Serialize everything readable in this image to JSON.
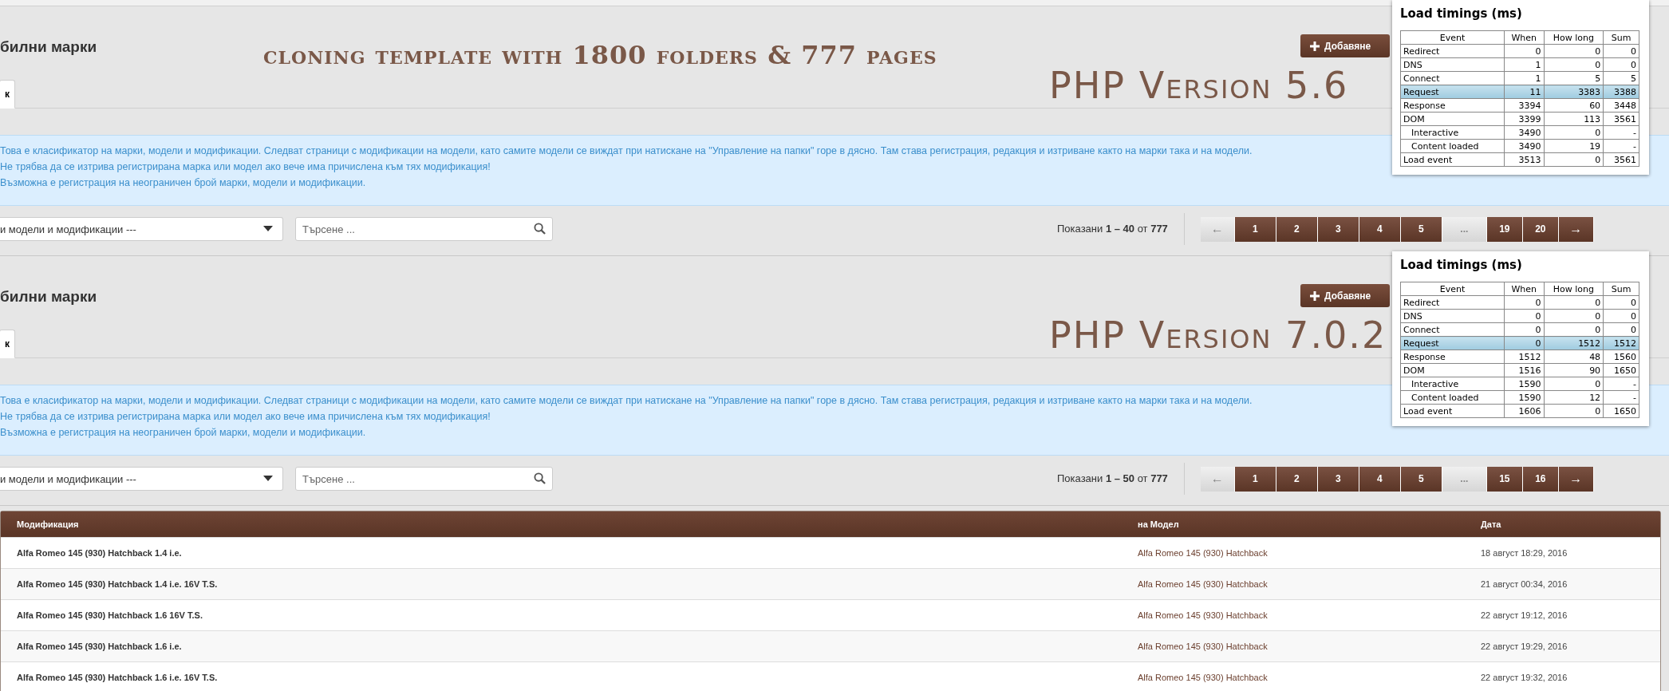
{
  "sections": [
    {
      "title": "билни марки",
      "annotation": "cloning template with 1800 folders & 777 pages",
      "add_button": "Добавяне",
      "version_label": "PHP Version 5.6",
      "tab": {
        "label": "к",
        "selected": true
      },
      "info_lines": [
        "Това е класификатор на марки, модели и модификации. Следват страници с модификации на модели, като самите модели се виждат при натискане на \"Управление на папки\" горе в дясно. Там става регистрация, редакция и изтриване както на марки така и на модели.",
        "Не трябва да се изтрива регистрирана марка или модел ако вече има причислена към тях модификация!",
        "Възможна е регистрация на неограничен брой марки, модели и модификации."
      ],
      "filter_select": "и модели и модификации ---",
      "search": {
        "placeholder": "Търсене ..."
      },
      "showing": "Показани **1 – 40** от **777**",
      "pagination": [
        {
          "kind": "prev",
          "label": "←",
          "disabled": true
        },
        {
          "kind": "page",
          "label": "1",
          "disabled": false
        },
        {
          "kind": "page",
          "label": "2",
          "disabled": false
        },
        {
          "kind": "page",
          "label": "3",
          "disabled": false
        },
        {
          "kind": "page",
          "label": "4",
          "disabled": false
        },
        {
          "kind": "page",
          "label": "5",
          "disabled": false
        },
        {
          "kind": "gap",
          "label": "...",
          "disabled": true
        },
        {
          "kind": "page",
          "label": "19",
          "disabled": false
        },
        {
          "kind": "page",
          "label": "20",
          "disabled": false
        },
        {
          "kind": "next",
          "label": "→",
          "disabled": false
        }
      ],
      "timings": {
        "title": "Load timings (ms)",
        "columns": [
          "Event",
          "When",
          "How long",
          "Sum"
        ],
        "rows": [
          {
            "event": "Redirect",
            "when": "0",
            "how_long": "0",
            "sum": "0",
            "highlighted": false
          },
          {
            "event": "DNS",
            "when": "1",
            "how_long": "0",
            "sum": "0",
            "highlighted": false
          },
          {
            "event": "Connect",
            "when": "1",
            "how_long": "5",
            "sum": "5",
            "highlighted": false
          },
          {
            "event": "Request",
            "when": "11",
            "how_long": "3383",
            "sum": "3388",
            "highlighted": true
          },
          {
            "event": "Response",
            "when": "3394",
            "how_long": "60",
            "sum": "3448",
            "highlighted": false
          },
          {
            "event": "DOM",
            "when": "3399",
            "how_long": "113",
            "sum": "3561",
            "highlighted": false,
            "children": [
              {
                "event": "Interactive",
                "when": "3490",
                "how_long": "0",
                "sum": "-",
                "highlighted": false
              },
              {
                "event": "Content loaded",
                "when": "3490",
                "how_long": "19",
                "sum": "-",
                "highlighted": false
              }
            ]
          },
          {
            "event": "Load event",
            "when": "3513",
            "how_long": "0",
            "sum": "3561",
            "highlighted": false
          }
        ]
      }
    },
    {
      "title": "билни марки",
      "add_button": "Добавяне",
      "version_label": "PHP Version 7.0.2",
      "tab": {
        "label": "к",
        "selected": true
      },
      "info_lines": [
        "Това е класификатор на марки, модели и модификации. Следват страници с модификации на модели, като самите модели се виждат при натискане на \"Управление на папки\" горе в дясно. Там става регистрация, редакция и изтриване както на марки така и на модели.",
        "Не трябва да се изтрива регистрирана марка или модел ако вече има причислена към тях модификация!",
        "Възможна е регистрация на неограничен брой марки, модели и модификации."
      ],
      "filter_select": "и модели и модификации ---",
      "search": {
        "placeholder": "Търсене ..."
      },
      "showing": "Показани **1 – 50** от **777**",
      "pagination": [
        {
          "kind": "prev",
          "label": "←",
          "disabled": true
        },
        {
          "kind": "page",
          "label": "1",
          "disabled": false
        },
        {
          "kind": "page",
          "label": "2",
          "disabled": false
        },
        {
          "kind": "page",
          "label": "3",
          "disabled": false
        },
        {
          "kind": "page",
          "label": "4",
          "disabled": false
        },
        {
          "kind": "page",
          "label": "5",
          "disabled": false
        },
        {
          "kind": "gap",
          "label": "...",
          "disabled": true
        },
        {
          "kind": "page",
          "label": "15",
          "disabled": false
        },
        {
          "kind": "page",
          "label": "16",
          "disabled": false
        },
        {
          "kind": "next",
          "label": "→",
          "disabled": false
        }
      ],
      "timings": {
        "title": "Load timings (ms)",
        "columns": [
          "Event",
          "When",
          "How long",
          "Sum"
        ],
        "rows": [
          {
            "event": "Redirect",
            "when": "0",
            "how_long": "0",
            "sum": "0",
            "highlighted": false
          },
          {
            "event": "DNS",
            "when": "0",
            "how_long": "0",
            "sum": "0",
            "highlighted": false
          },
          {
            "event": "Connect",
            "when": "0",
            "how_long": "0",
            "sum": "0",
            "highlighted": false
          },
          {
            "event": "Request",
            "when": "0",
            "how_long": "1512",
            "sum": "1512",
            "highlighted": true
          },
          {
            "event": "Response",
            "when": "1512",
            "how_long": "48",
            "sum": "1560",
            "highlighted": false
          },
          {
            "event": "DOM",
            "when": "1516",
            "how_long": "90",
            "sum": "1650",
            "highlighted": false,
            "children": [
              {
                "event": "Interactive",
                "when": "1590",
                "how_long": "0",
                "sum": "-",
                "highlighted": false
              },
              {
                "event": "Content loaded",
                "when": "1590",
                "how_long": "12",
                "sum": "-",
                "highlighted": false
              }
            ]
          },
          {
            "event": "Load event",
            "when": "1606",
            "how_long": "0",
            "sum": "1650",
            "highlighted": false
          }
        ]
      }
    }
  ],
  "table": {
    "columns": [
      "Модификация",
      "на Модел",
      "Дата"
    ],
    "rows": [
      [
        "Alfa Romeo 145 (930) Hatchback 1.4 i.e.",
        "Alfa Romeo 145 (930) Hatchback",
        "18 август 18:29, 2016"
      ],
      [
        "Alfa Romeo 145 (930) Hatchback 1.4 i.e. 16V T.S.",
        "Alfa Romeo 145 (930) Hatchback",
        "21 август 00:34, 2016"
      ],
      [
        "Alfa Romeo 145 (930) Hatchback 1.6 16V T.S.",
        "Alfa Romeo 145 (930) Hatchback",
        "22 август 19:12, 2016"
      ],
      [
        "Alfa Romeo 145 (930) Hatchback 1.6 i.e.",
        "Alfa Romeo 145 (930) Hatchback",
        "22 август 19:29, 2016"
      ],
      [
        "Alfa Romeo 145 (930) Hatchback 1.6 i.e. 16V T.S.",
        "Alfa Romeo 145 (930) Hatchback",
        "22 август 19:32, 2016"
      ]
    ]
  }
}
